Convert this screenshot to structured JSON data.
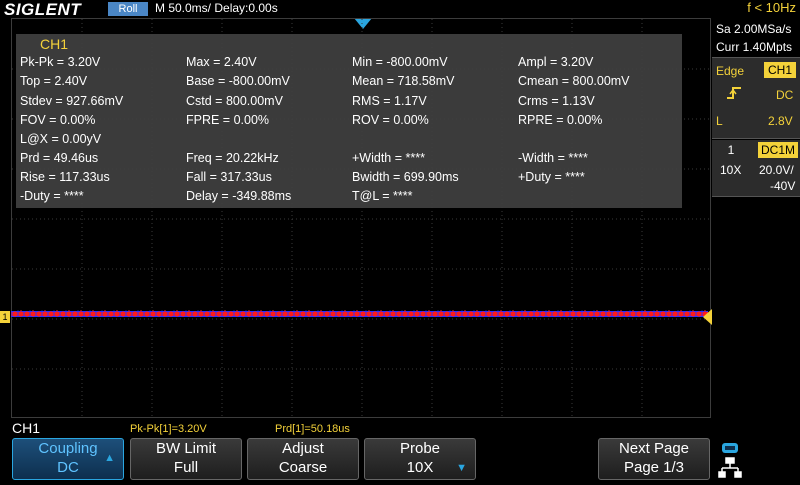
{
  "header": {
    "brand": "SIGLENT",
    "mode": "Roll",
    "timebase": "M 50.0ms/ Delay:0.00s",
    "frequency": "f < 10Hz"
  },
  "measurements": {
    "title": "CH1",
    "items": [
      "Pk-Pk = 3.20V",
      "Max = 2.40V",
      "Min = -800.00mV",
      "Ampl = 3.20V",
      "Top = 2.40V",
      "Base = -800.00mV",
      "Mean = 718.58mV",
      "Cmean = 800.00mV",
      "Stdev = 927.66mV",
      "Cstd = 800.00mV",
      "RMS = 1.17V",
      "Crms = 1.13V",
      "FOV = 0.00%",
      "FPRE = 0.00%",
      "ROV = 0.00%",
      "RPRE = 0.00%",
      "L@X = 0.00yV",
      "Prd = 49.46us",
      "Freq = 20.22kHz",
      "+Width = ****",
      "-Width = ****",
      "Rise = 117.33us",
      "Fall = 317.33us",
      "Bwidth = 699.90ms",
      "+Duty = ****",
      "-Duty = ****",
      "Delay = -349.88ms",
      "T@L = ****"
    ]
  },
  "channel_marker": "1",
  "right_panel": {
    "sample_rate": "Sa 2.00MSa/s",
    "memory": "Curr 1.40Mpts",
    "trigger_type": "Edge",
    "trigger_source": "CH1",
    "trigger_slope_icon": "rising-edge-icon",
    "trigger_coupling": "DC",
    "trigger_level_label": "L",
    "trigger_level": "2.8V",
    "channel_number": "1",
    "channel_coupling": "DC1M",
    "probe": "10X",
    "volts_div": "20.0V/",
    "offset": "-40V"
  },
  "bottom": {
    "menu_title": "CH1",
    "stat_pkpk": "Pk-Pk[1]=3.20V",
    "stat_prd": "Prd[1]=50.18us",
    "softkeys": [
      {
        "line1": "Coupling",
        "line2": "DC"
      },
      {
        "line1": "BW Limit",
        "line2": "Full"
      },
      {
        "line1": "Adjust",
        "line2": "Coarse"
      },
      {
        "line1": "Probe",
        "line2": "10X"
      },
      {
        "line1": "Next Page",
        "line2": "Page 1/3"
      }
    ]
  },
  "colors": {
    "accent": "#2aa6e0",
    "channel1": "#f4d23a",
    "trace_red": "#ff1a1a",
    "trace_blue": "#3030ff"
  }
}
